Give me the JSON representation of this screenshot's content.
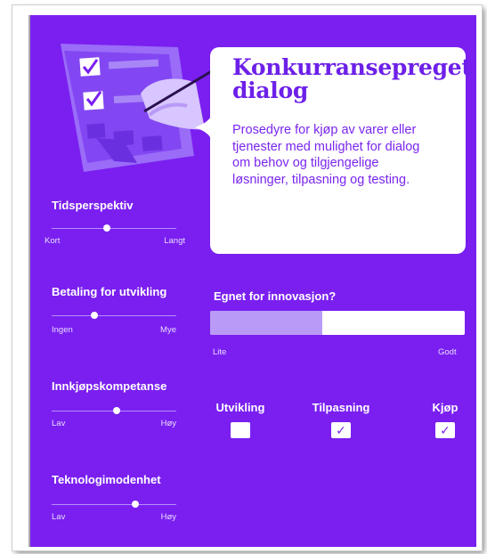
{
  "header": {
    "title": "Konkurransepreget dialog",
    "description": "Prosedyre for kjøp av varer eller tjenester med mulighet for dialog om behov og tilgjengelige løsninger, tilpasning og testing."
  },
  "sliders": [
    {
      "label": "Tidsperspektiv",
      "low": "Kort",
      "high": "Langt",
      "value": 0.44
    },
    {
      "label": "Betaling for utvikling",
      "low": "Ingen",
      "high": "Mye",
      "value": 0.34
    },
    {
      "label": "Innkjøpskompetanse",
      "low": "Lav",
      "high": "Høy",
      "value": 0.52
    },
    {
      "label": "Teknologimodenhet",
      "low": "Lav",
      "high": "Høy",
      "value": 0.67
    }
  ],
  "innovation": {
    "label": "Egnet for innovasjon?",
    "low": "Lite",
    "high": "Godt",
    "value": 0.44
  },
  "procurement_types": [
    {
      "label": "Utvikling",
      "checked": false
    },
    {
      "label": "Tilpasning",
      "checked": true
    },
    {
      "label": "Kjøp",
      "checked": true
    }
  ],
  "check_glyph": "✓",
  "colors": {
    "background": "#7a1ff0",
    "title": "#6d20e8",
    "bar_fill": "#b99af7",
    "track": "#b98cff"
  },
  "icons": {
    "illustration": "checklist-hand-writing-illustration"
  }
}
